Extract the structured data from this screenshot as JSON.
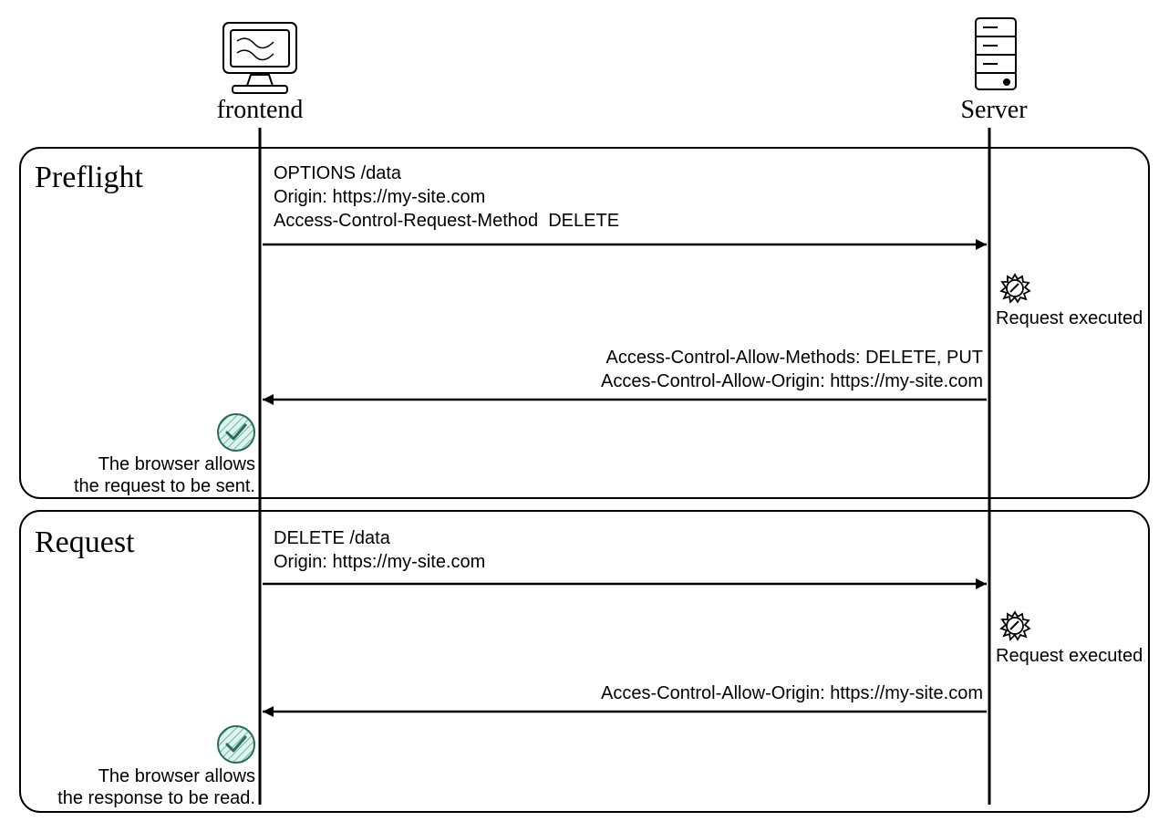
{
  "actors": {
    "frontend": {
      "label": "frontend"
    },
    "server": {
      "label": "Server"
    }
  },
  "phases": {
    "preflight": {
      "title": "Preflight",
      "request": {
        "line1": "OPTIONS /data",
        "line2": "Origin: https://my-site.com",
        "line3": "Access-Control-Request-Method  DELETE"
      },
      "server_note": "Request executed",
      "response": {
        "line1": "Access-Control-Allow-Methods: DELETE, PUT",
        "line2": "Acces-Control-Allow-Origin: https://my-site.com"
      },
      "browser_note": {
        "line1": "The browser allows",
        "line2": "the request to be sent."
      }
    },
    "request": {
      "title": "Request",
      "request": {
        "line1": "DELETE /data",
        "line2": "Origin: https://my-site.com"
      },
      "server_note": "Request executed",
      "response": {
        "line1": "Acces-Control-Allow-Origin: https://my-site.com"
      },
      "browser_note": {
        "line1": "The browser allows",
        "line2": "the response to be read."
      }
    }
  },
  "icons": {
    "frontend": "computer-icon",
    "server": "server-icon",
    "gear": "gear-icon",
    "check": "check-icon"
  }
}
